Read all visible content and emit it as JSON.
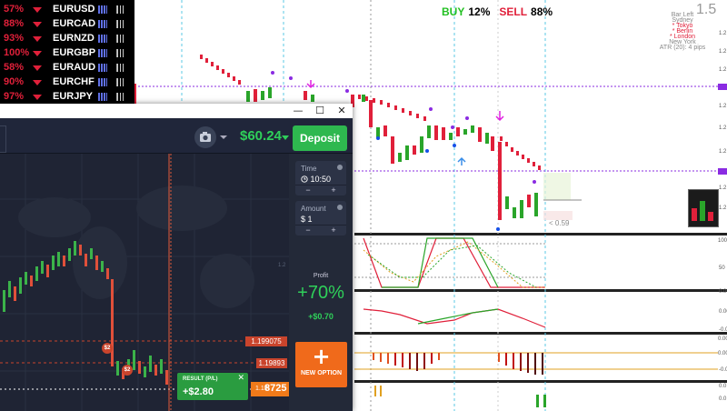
{
  "watchlist": [
    {
      "pct": "57%",
      "symbol": "EURUSD"
    },
    {
      "pct": "88%",
      "symbol": "EURCAD"
    },
    {
      "pct": "93%",
      "symbol": "EURNZD"
    },
    {
      "pct": "100%",
      "symbol": "EURGBP"
    },
    {
      "pct": "58%",
      "symbol": "EURAUD"
    },
    {
      "pct": "90%",
      "symbol": "EURCHF"
    },
    {
      "pct": "97%",
      "symbol": "EURJPY"
    }
  ],
  "signal": {
    "buy_label": "BUY",
    "buy_value": "12%",
    "sell_label": "SELL",
    "sell_value": "88%"
  },
  "price_big": "1.5",
  "sessions": [
    {
      "text": "Bar Left",
      "red": false
    },
    {
      "text": "Sydney",
      "red": false
    },
    {
      "text": "* Tokyo",
      "red": true
    },
    {
      "text": "* Berlin",
      "red": true
    },
    {
      "text": "* London",
      "red": true
    },
    {
      "text": "New York",
      "red": false
    },
    {
      "text": "ATR (20): 4 pips",
      "red": false
    }
  ],
  "level_label": "< 0.59",
  "broker": {
    "balance": "$60.24",
    "deposit_label": "Deposit",
    "time_label": "Time",
    "time_value": "10:50",
    "amount_label": "Amount",
    "amount_value": "$ 1",
    "minus": "−",
    "plus": "+",
    "profit_label": "Profit",
    "profit_pct": "+70%",
    "profit_amount": "+$0.70",
    "new_option_label": "NEW OPTION",
    "price_tag_1": "1.199075",
    "price_tag_2": "1.19893",
    "result_label": "RESULT (P/L)",
    "result_value": "+$2.80",
    "current_price_prefix": "1.19",
    "current_price_main": "8725",
    "trade_badge": "$2",
    "axis_label": "1.2"
  },
  "colors": {
    "green": "#2fd05a",
    "deposit": "#2eb84f",
    "new_option": "#f06a1b",
    "sell_red": "#e0203a"
  }
}
